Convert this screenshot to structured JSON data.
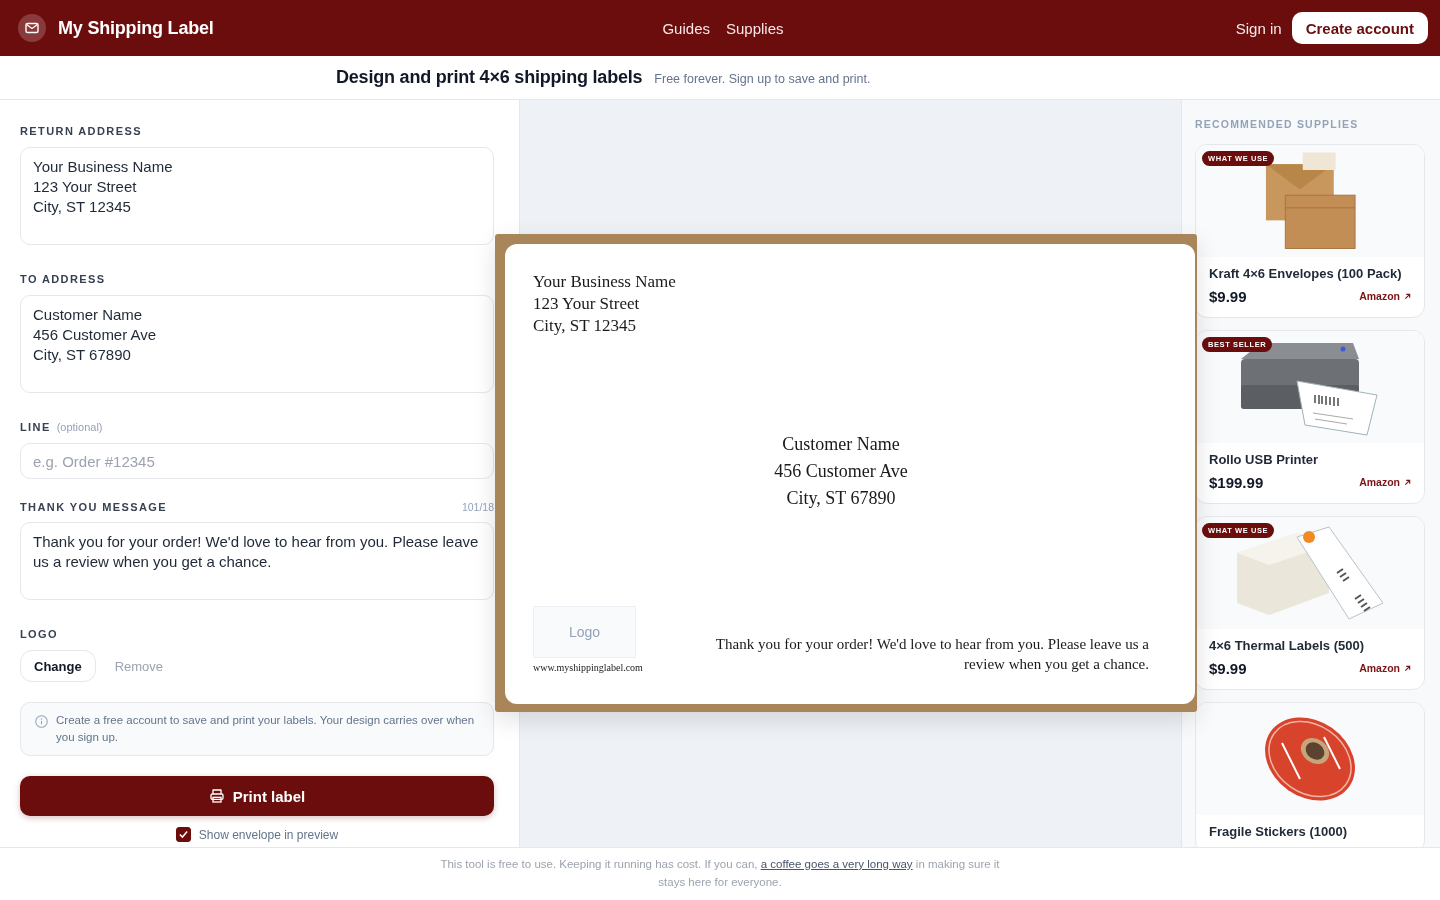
{
  "header": {
    "brand": "My Shipping Label",
    "nav": [
      {
        "label": "Guides"
      },
      {
        "label": "Supplies"
      }
    ],
    "sign_in": "Sign in",
    "create_account": "Create account"
  },
  "intro": {
    "title": "Design and print 4×6 shipping labels",
    "subtitle": "Free forever. Sign up to save and print."
  },
  "form": {
    "return_address": {
      "label": "RETURN ADDRESS",
      "value": "Your Business Name\n123 Your Street\nCity, ST 12345"
    },
    "to_address": {
      "label": "TO ADDRESS",
      "value": "Customer Name\n456 Customer Ave\nCity, ST 67890"
    },
    "line": {
      "label": "LINE",
      "hint": "(optional)",
      "placeholder": "e.g. Order #12345"
    },
    "thank_you": {
      "label": "THANK YOU MESSAGE",
      "counter": "101/18",
      "value": "Thank you for your order! We'd love to hear from you. Please leave us a review when you get a chance."
    },
    "logo": {
      "label": "LOGO",
      "change": "Change",
      "remove": "Remove"
    },
    "notice": "Create a free account to save and print your labels. Your design carries over when you sign up.",
    "print_button": "Print label",
    "show_envelope": {
      "label": "Show envelope in preview",
      "checked": true
    }
  },
  "preview": {
    "return_address": [
      "Your Business Name",
      "123 Your Street",
      "City, ST 12345"
    ],
    "to_address": [
      "Customer Name",
      "456 Customer Ave",
      "City, ST 67890"
    ],
    "logo_placeholder": "Logo",
    "website": "www.myshippinglabel.com",
    "message": "Thank you for your order! We'd love to hear from you. Please leave us a review when you get a chance."
  },
  "supplies": {
    "heading": "RECOMMENDED SUPPLIES",
    "items": [
      {
        "kind": "envelopes",
        "badge": "WHAT WE USE",
        "name": "Kraft 4×6 Envelopes (100 Pack)",
        "price": "$9.99",
        "link": "Amazon"
      },
      {
        "kind": "printer",
        "badge": "BEST SELLER",
        "name": "Rollo USB Printer",
        "price": "$199.99",
        "link": "Amazon"
      },
      {
        "kind": "labels",
        "badge": "WHAT WE USE",
        "name": "4×6 Thermal Labels (500)",
        "price": "$9.99",
        "link": "Amazon"
      },
      {
        "kind": "stickers",
        "name": "Fragile Stickers (1000)"
      }
    ]
  },
  "footer": {
    "before": "This tool is free to use. Keeping it running has cost. If you can, ",
    "link": "a coffee goes a very long way",
    "after": " in making sure it stays here for everyone."
  }
}
